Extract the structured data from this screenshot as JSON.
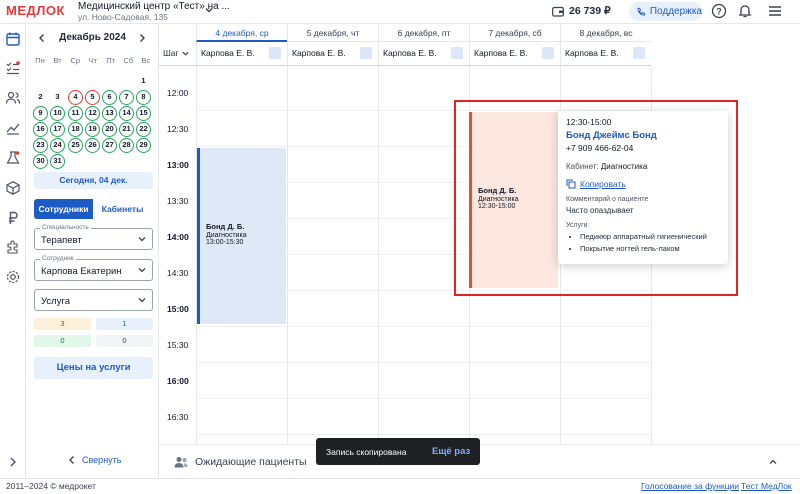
{
  "header": {
    "logo": "МЕДЛОК",
    "org_name": "Медицинский центр «Тест» на ...",
    "org_address": "ул. Ново-Садовая, 135",
    "balance": "26 739 ₽",
    "support_label": "Поддержка"
  },
  "calendar": {
    "month_label": "Декабрь 2024",
    "weekdays": [
      "Пн",
      "Вт",
      "Ср",
      "Чт",
      "Пт",
      "Сб",
      "Вс"
    ],
    "today_button": "Сегодня, 04 дек."
  },
  "sidebar": {
    "tabs": [
      "Сотрудники",
      "Кабинеты"
    ],
    "specialty_label": "Специальность",
    "specialty_value": "Терапевт",
    "employee_label": "Сотрудник",
    "employee_value": "Карпова Екатерин",
    "service_value": "Услуга",
    "stats": [
      "3",
      "1",
      "0",
      "0"
    ],
    "prices_button": "Цены на услуги",
    "collapse_label": "Свернуть"
  },
  "schedule": {
    "step_label": "Шаг",
    "days": [
      "4 декабря, ср",
      "5 декабря, чт",
      "6 декабря, пт",
      "7 декабря, сб",
      "8 декабря, вс"
    ],
    "staff": [
      "Карпова Е. В.",
      "Карпова Е. В.",
      "Карпова Е. В.",
      "Карпова Е. В.",
      "Карпова Е. В."
    ],
    "times": [
      "12:00",
      "12:30",
      "13:00",
      "13:30",
      "14:00",
      "14:30",
      "15:00",
      "15:30",
      "16:00",
      "16:30"
    ],
    "appointments": [
      {
        "name": "Бонд Д. Б.",
        "service": "Диагностика",
        "time": "13:00-15:30"
      },
      {
        "name": "Бонд Д. Б.",
        "service": "Диагностика",
        "time": "12:30-15:00"
      }
    ]
  },
  "popup": {
    "time": "12:30-15:00",
    "patient_name": "Бонд Джеймс Бонд",
    "phone": "+7 909 466-62-04",
    "cabinet_label": "Кабинет:",
    "cabinet_value": "Диагностика",
    "copy_label": "Копировать",
    "comment_label": "Комментарий о пациенте",
    "comment_value": "Часто опаздывает",
    "services_label": "Услуги",
    "services": [
      "Педикюр аппаратный гигиенический",
      "Покрытие ногтей гель-лаком"
    ]
  },
  "waiting": {
    "label": "Ожидающие пациенты"
  },
  "toast": {
    "message": "Запись скопирована",
    "action": "Ещё раз"
  },
  "footer": {
    "copyright": "2011–2024 © медрокет",
    "vote_link": "Голосование за функции",
    "test_link": "Тест МедЛок"
  },
  "colors": {
    "accent": "#1d5bc4",
    "brand": "#e23b3b",
    "highlight": "#e02424",
    "appt_blue": "#dfe8f7",
    "appt_orange": "#fbe7df"
  }
}
